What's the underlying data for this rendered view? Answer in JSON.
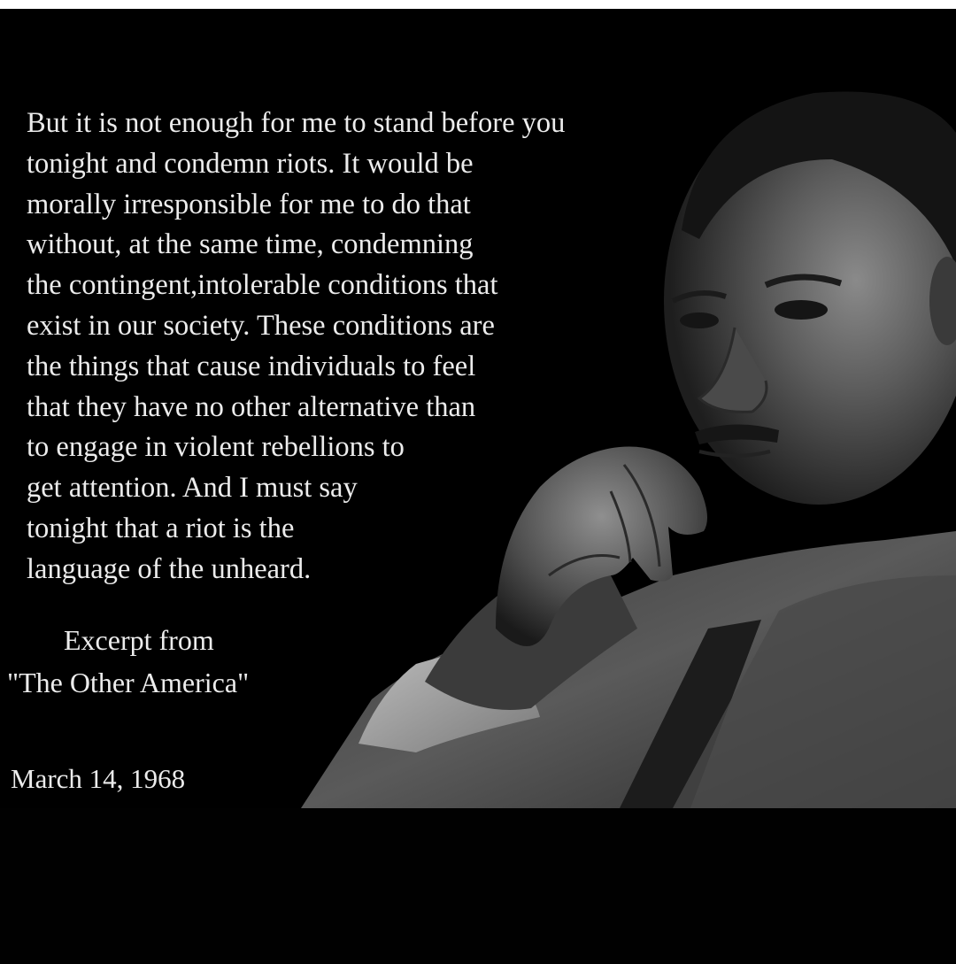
{
  "quote": {
    "lines": [
      "But it is not enough for me to stand before you",
      "tonight and condemn riots. It would be",
      "morally irresponsible for me to do that",
      "without, at the same time, condemning",
      "the contingent,intolerable conditions that",
      "exist in our society. These conditions are",
      "the things that cause individuals to feel",
      "that they have no other alternative than",
      "to engage in violent rebellions to",
      "get attention. And I must say",
      "tonight that a riot is the",
      "language of the unheard."
    ]
  },
  "source": {
    "excerpt_label": "Excerpt from",
    "title": "\"The Other America\""
  },
  "date": "March 14, 1968",
  "colors": {
    "background": "#000000",
    "text": "#ececec",
    "top_strip": "#ffffff"
  }
}
